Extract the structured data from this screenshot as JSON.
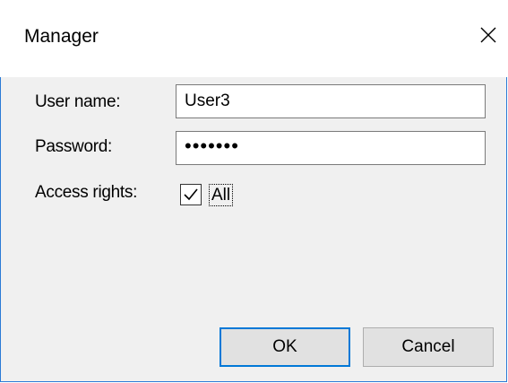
{
  "window": {
    "title": "Manager",
    "close_icon": "close-icon"
  },
  "form": {
    "user_name_label": "User name:",
    "user_name_value": "User3",
    "password_label": "Password:",
    "password_value": "•••••••",
    "access_rights_label": "Access rights:",
    "access_all_label": "All",
    "access_all_checked": true
  },
  "buttons": {
    "ok_label": "OK",
    "cancel_label": "Cancel"
  },
  "colors": {
    "accent": "#0078d7",
    "window_border": "#2b7bd6"
  }
}
